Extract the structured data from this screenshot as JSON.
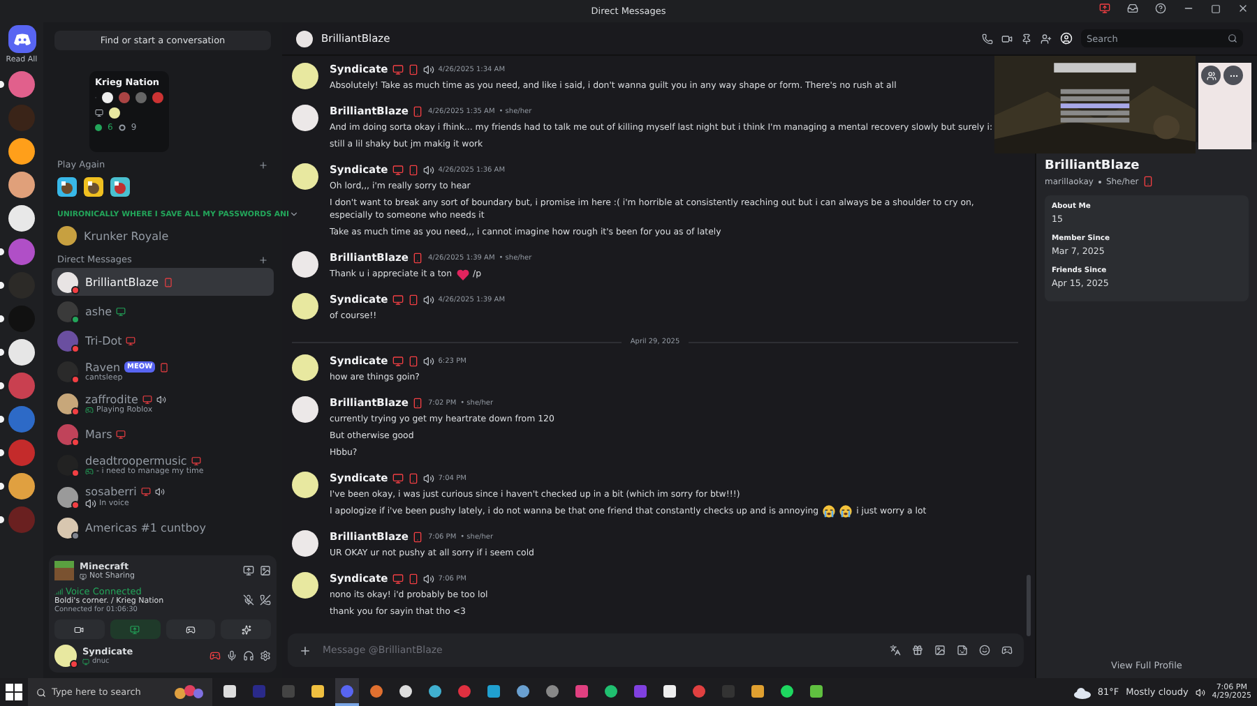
{
  "window": {
    "title": "Direct Messages"
  },
  "rail": {
    "home_label": "Read All",
    "servers": [
      {
        "unread": true
      },
      {
        "unread": false
      },
      {
        "unread": false
      },
      {
        "unread": false
      },
      {
        "unread": false
      },
      {
        "unread": true
      },
      {
        "unread": true
      },
      {
        "unread": true
      },
      {
        "unread": true
      },
      {
        "unread": true
      },
      {
        "unread": true
      },
      {
        "unread": true
      },
      {
        "unread": true
      },
      {
        "unread": true
      }
    ]
  },
  "tooltip": {
    "server": "Krieg Nation",
    "online": "6",
    "members": "9"
  },
  "sidebar": {
    "search_placeholder": "Find or start a conversation",
    "play_again_label": "Play Again",
    "games": [
      {
        "kind": "cow"
      },
      {
        "kind": "cat"
      },
      {
        "kind": "bird"
      }
    ],
    "folder": "UNIRONICALLY WHERE I SAVE ALL MY PASSWORDS ANI",
    "folder_expanded": true,
    "krunker": "Krunker Royale",
    "dm_label": "Direct Messages",
    "dms": [
      {
        "name": "BrilliantBlaze",
        "color": "#f23f43",
        "selected": true,
        "icons": [
          {
            "kind": "mobile"
          }
        ]
      },
      {
        "name": "ashe",
        "color": "#23a55a",
        "selected": false,
        "icons": [
          {
            "kind": "online"
          }
        ]
      },
      {
        "name": "Tri-Dot",
        "color": "#f23f43",
        "selected": false,
        "icons": [
          {
            "kind": "desktop"
          }
        ]
      },
      {
        "name": "Raven",
        "color": "#f23f43",
        "selected": false,
        "tag": "MEOW",
        "icons": [
          {
            "kind": "mobile"
          }
        ],
        "sub": {
          "text": "cantsleep"
        }
      },
      {
        "name": "zaffrodite",
        "color": "#f23f43",
        "selected": false,
        "icons": [
          {
            "kind": "desktop"
          },
          {
            "kind": "voice"
          }
        ],
        "sub": {
          "kind": "game",
          "text": "Playing Roblox"
        }
      },
      {
        "name": "Mars",
        "color": "#f23f43",
        "selected": false,
        "icons": [
          {
            "kind": "desktop"
          }
        ]
      },
      {
        "name": "deadtroopermusic",
        "color": "#f23f43",
        "selected": false,
        "icons": [
          {
            "kind": "desktop"
          }
        ],
        "sub": {
          "kind": "game",
          "text": "- i need to manage my time"
        }
      },
      {
        "name": "sosaberri",
        "color": "#f23f43",
        "selected": false,
        "icons": [
          {
            "kind": "desktop"
          },
          {
            "kind": "voice"
          }
        ],
        "sub": {
          "kind": "voice",
          "text": "In voice"
        }
      },
      {
        "name": "Americas #1 cuntboy",
        "color": "#80848e",
        "selected": false
      }
    ]
  },
  "activity": {
    "game": "Minecraft",
    "sharing": "Not Sharing"
  },
  "voice": {
    "state": "Voice Connected",
    "channel": "Boldi's corner. / Krieg Nation",
    "duration": "Connected for 01:06:30"
  },
  "user": {
    "name": "Syndicate",
    "status_text": "dnuc",
    "color": "#f23f43"
  },
  "chat": {
    "recipient": "BrilliantBlaze",
    "search_placeholder": "Search",
    "composer_placeholder": "Message @BrilliantBlaze",
    "messages": [
      {
        "author": "Syndicate",
        "icons": [
          {
            "kind": "desktop"
          },
          {
            "kind": "mobile"
          },
          {
            "kind": "voice"
          }
        ],
        "time": "4/26/2025 1:34 AM",
        "lines": [
          {
            "text": "Absolutely! Take as much time as you need, and like i said, i don't wanna guilt you in any way shape or form. There's no rush at all"
          }
        ]
      },
      {
        "author": "BrilliantBlaze",
        "icons": [
          {
            "kind": "mobile"
          }
        ],
        "time": "4/26/2025 1:35 AM",
        "pronouns": "• she/her",
        "lines": [
          {
            "text": "And im doing sorta okay i fhink... my friends had to talk me out of killing myself last night but i think I'm managing a mental recovery slowly but surely i:"
          },
          {
            "text": "still a lil shaky but jm makig it work"
          }
        ]
      },
      {
        "author": "Syndicate",
        "icons": [
          {
            "kind": "desktop"
          },
          {
            "kind": "mobile"
          },
          {
            "kind": "voice"
          }
        ],
        "time": "4/26/2025 1:36 AM",
        "lines": [
          {
            "text": "Oh lord,,, i'm really sorry to hear"
          },
          {
            "text": "I don't want to break any sort of boundary but, i promise im here :( i'm horrible at consistently reaching out but i can always be a shoulder to cry on, especially to someone who needs it"
          },
          {
            "text": "Take as much time as you need,,, i cannot imagine how rough it's been for you as of lately"
          }
        ]
      },
      {
        "author": "BrilliantBlaze",
        "icons": [
          {
            "kind": "mobile"
          }
        ],
        "time": "4/26/2025 1:39 AM",
        "pronouns": "• she/her",
        "lines": [
          {
            "text": "Thank u i appreciate it a ton",
            "emojis": [
              {
                "kind": "heart"
              }
            ],
            "tail": "/p"
          }
        ]
      },
      {
        "author": "Syndicate",
        "icons": [
          {
            "kind": "desktop"
          },
          {
            "kind": "mobile"
          },
          {
            "kind": "voice"
          }
        ],
        "time": "4/26/2025 1:39 AM",
        "lines": [
          {
            "text": "of course!!"
          }
        ]
      },
      {
        "divider": "April 29, 2025"
      },
      {
        "author": "Syndicate",
        "icons": [
          {
            "kind": "desktop"
          },
          {
            "kind": "mobile"
          },
          {
            "kind": "voice"
          }
        ],
        "time": "6:23 PM",
        "lines": [
          {
            "text": "how are things goin?"
          }
        ]
      },
      {
        "author": "BrilliantBlaze",
        "icons": [
          {
            "kind": "mobile"
          }
        ],
        "time": "7:02 PM",
        "pronouns": "• she/her",
        "lines": [
          {
            "text": "currently trying yo get my heartrate down from 120"
          },
          {
            "text": "But otherwise good"
          },
          {
            "text": "Hbbu?"
          }
        ]
      },
      {
        "author": "Syndicate",
        "icons": [
          {
            "kind": "desktop"
          },
          {
            "kind": "mobile"
          },
          {
            "kind": "voice"
          }
        ],
        "time": "7:04 PM",
        "lines": [
          {
            "text": "I've been okay, i was just curious since i haven't checked up in a bit (which im sorry for btw!!!)"
          },
          {
            "text": "I apologize if i've been pushy lately, i do not wanna be that one friend that constantly checks up and is annoying",
            "emojis": [
              {
                "kind": "sob"
              },
              {
                "kind": "sob"
              }
            ],
            "tail": "i just worry a lot"
          }
        ]
      },
      {
        "author": "BrilliantBlaze",
        "icons": [
          {
            "kind": "mobile"
          }
        ],
        "time": "7:06 PM",
        "pronouns": "• she/her",
        "lines": [
          {
            "text": "UR OKAY ur not pushy at all sorry if i seem cold"
          }
        ]
      },
      {
        "author": "Syndicate",
        "icons": [
          {
            "kind": "desktop"
          },
          {
            "kind": "mobile"
          },
          {
            "kind": "voice"
          }
        ],
        "time": "7:06 PM",
        "lines": [
          {
            "text": "nono its okay! i'd probably be too lol"
          },
          {
            "text": "thank you for sayin that tho <3"
          }
        ]
      }
    ]
  },
  "profile": {
    "name": "BrilliantBlaze",
    "username": "marillaokay",
    "pronouns": "She/her",
    "sections": [
      {
        "label": "About Me",
        "value": "15"
      },
      {
        "label": "Member Since",
        "value": "Mar 7, 2025"
      },
      {
        "label": "Friends Since",
        "value": "Apr 15, 2025"
      }
    ],
    "full_profile_link": "View Full Profile"
  },
  "taskbar": {
    "search_placeholder": "Type here to search",
    "apps": [
      {
        "kind": "view"
      },
      {
        "kind": "an"
      },
      {
        "kind": "epic"
      },
      {
        "kind": "folder"
      },
      {
        "kind": "discord",
        "selected": true
      },
      {
        "kind": "shield"
      },
      {
        "kind": "vc"
      },
      {
        "kind": "fish"
      },
      {
        "kind": "ring"
      },
      {
        "kind": "c"
      },
      {
        "kind": "steam"
      },
      {
        "kind": "atom"
      },
      {
        "kind": "pink"
      },
      {
        "kind": "xbox"
      },
      {
        "kind": "roblox"
      },
      {
        "kind": "m"
      },
      {
        "kind": "switch"
      },
      {
        "kind": "dark"
      },
      {
        "kind": "glasses"
      },
      {
        "kind": "spotify"
      },
      {
        "kind": "block"
      }
    ],
    "weather": "81°F",
    "weather_text": "Mostly cloudy",
    "time": "7:06 PM",
    "date": "4/29/2025"
  }
}
